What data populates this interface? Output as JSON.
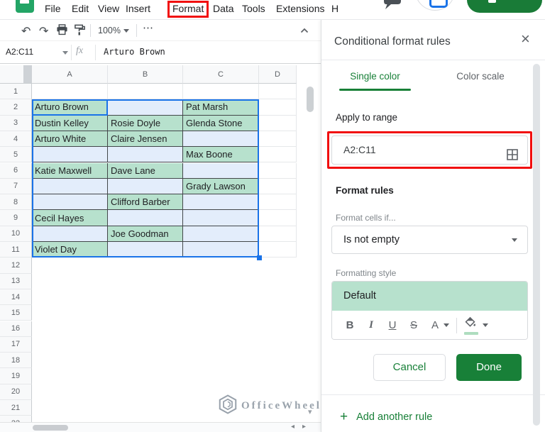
{
  "menu_bar": {
    "items": [
      "File",
      "Edit",
      "View",
      "Insert",
      "Format",
      "Data",
      "Tools",
      "Extensions",
      "Help"
    ],
    "highlighted_item": "Format"
  },
  "toolbar": {
    "zoom_value": "100%",
    "more_label": "⋯"
  },
  "formula_bar": {
    "name_box_value": "A2:C11",
    "fx_label": "fx",
    "formula_value": "Arturo Brown"
  },
  "grid": {
    "columns": [
      "A",
      "B",
      "C",
      "D"
    ],
    "row_count": 22,
    "selected_range": "A2:C11",
    "active_cell": "A2",
    "first_data_row": 2,
    "cells": [
      [
        "Arturo Brown",
        "",
        "Pat Marsh"
      ],
      [
        "Dustin Kelley",
        "Rosie Doyle",
        "Glenda Stone"
      ],
      [
        "Arturo White",
        "Claire Jensen",
        ""
      ],
      [
        "",
        "",
        "Max Boone"
      ],
      [
        "Katie Maxwell",
        "Dave Lane",
        ""
      ],
      [
        "",
        "",
        "Grady Lawson"
      ],
      [
        "",
        "Clifford Barber",
        ""
      ],
      [
        "Cecil Hayes",
        "",
        ""
      ],
      [
        "",
        "Joe Goodman",
        ""
      ],
      [
        "Violet Day",
        "",
        ""
      ]
    ]
  },
  "panel": {
    "title": "Conditional format rules",
    "close_label": "×",
    "tabs": {
      "single_color": "Single color",
      "color_scale": "Color scale",
      "active": "Single color"
    },
    "apply_to_range_label": "Apply to range",
    "range_value": "A2:C11",
    "format_rules_heading": "Format rules",
    "format_cells_if_label": "Format cells if...",
    "condition_value": "Is not empty",
    "formatting_style_label": "Formatting style",
    "style_preview_text": "Default",
    "bold_label": "B",
    "italic_label": "I",
    "underline_label": "U",
    "strikethrough_label": "S",
    "text_color_label": "A",
    "cancel_label": "Cancel",
    "done_label": "Done",
    "add_plus_label": "+",
    "add_rule_label": "Add another rule"
  },
  "watermark": {
    "text": "OfficeWheel"
  },
  "colors": {
    "accent_green": "#188038",
    "done_button_green": "#188038",
    "conditional_fill_green": "#b7e1cd",
    "selection_fill_blue": "#e3edfb",
    "selection_border_blue": "#1a73e8",
    "annotation_red": "#f10f0f"
  }
}
